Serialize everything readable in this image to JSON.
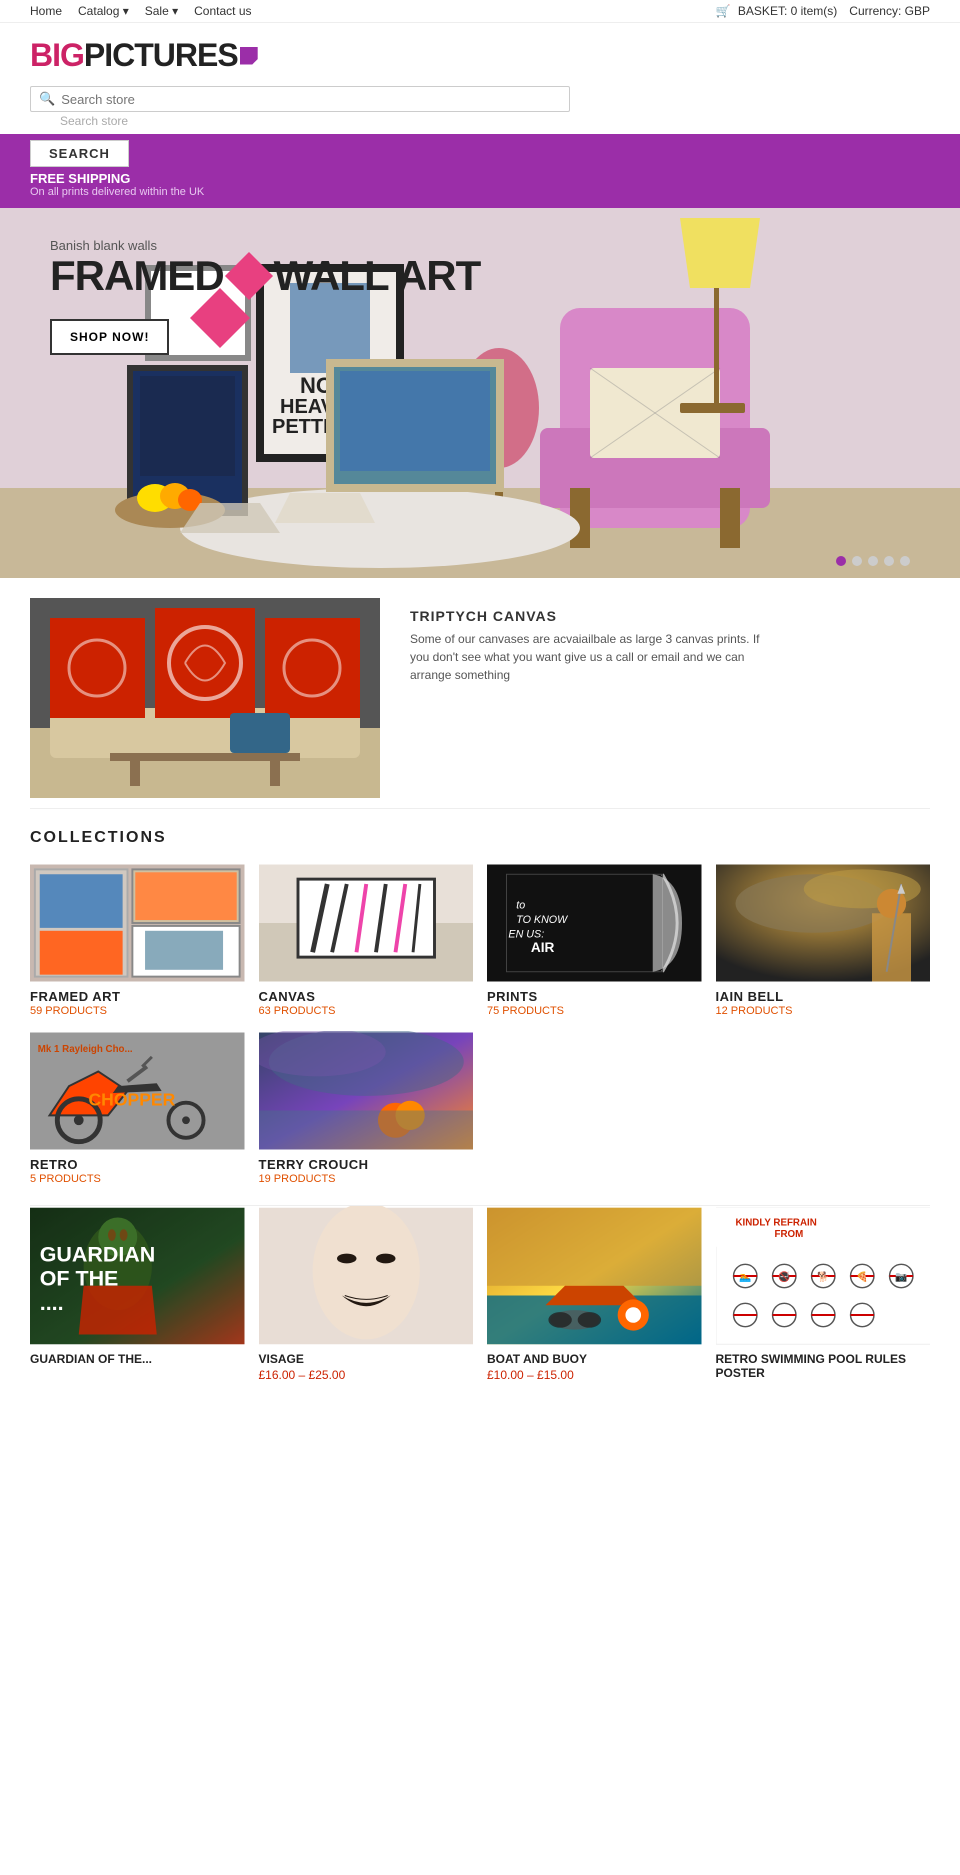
{
  "topbar": {
    "nav_links": [
      "Home",
      "Catalog",
      "Sale",
      "Contact us"
    ],
    "basket_label": "BASKET:",
    "basket_count": "0 item(s)",
    "currency_label": "Currency:",
    "currency_value": "GBP"
  },
  "search": {
    "placeholder": "Search store",
    "button_label": "SEARCH"
  },
  "promo": {
    "title": "FREE SHIPPING",
    "subtitle": "On all prints delivered within the UK"
  },
  "hero": {
    "banish_text": "Banish blank walls",
    "title_line1": "FRAMED WALL ART",
    "shop_now": "SHOP NOW!",
    "dots": [
      1,
      2,
      3,
      4,
      5
    ]
  },
  "triptych": {
    "title": "TRIPTYCH CANVAS",
    "description": "Some of our canvases are acvaiailbale as large 3 canvas prints. If you don't see what you want give us a call or email and we can arrange something"
  },
  "collections": {
    "heading": "COLLECTIONS",
    "items": [
      {
        "name": "FRAMED ART",
        "count": "59 PRODUCTS",
        "thumb_type": "framed"
      },
      {
        "name": "CANVAS",
        "count": "63 PRODUCTS",
        "thumb_type": "canvas"
      },
      {
        "name": "PRINTS",
        "count": "75 PRODUCTS",
        "thumb_type": "prints"
      },
      {
        "name": "IAIN BELL",
        "count": "12 PRODUCTS",
        "thumb_type": "iain"
      },
      {
        "name": "RETRO",
        "count": "5 PRODUCTS",
        "thumb_type": "retro"
      },
      {
        "name": "TERRY CROUCH",
        "count": "19 PRODUCTS",
        "thumb_type": "terry"
      }
    ]
  },
  "bottom_products": [
    {
      "name": "GUARDIAN OF THE...",
      "thumb_type": "guardian",
      "price": ""
    },
    {
      "name": "VISAGE",
      "thumb_type": "visage",
      "price": "£16.00 – £25.00"
    },
    {
      "name": "BOAT AND BUOY",
      "thumb_type": "boat",
      "price": "£10.00 – £15.00"
    },
    {
      "name": "RETRO SWIMMING POOL RULES POSTER",
      "thumb_type": "pool",
      "price": ""
    }
  ],
  "logo": {
    "text_big": "BIG",
    "text_pictures": "PICTURES"
  }
}
